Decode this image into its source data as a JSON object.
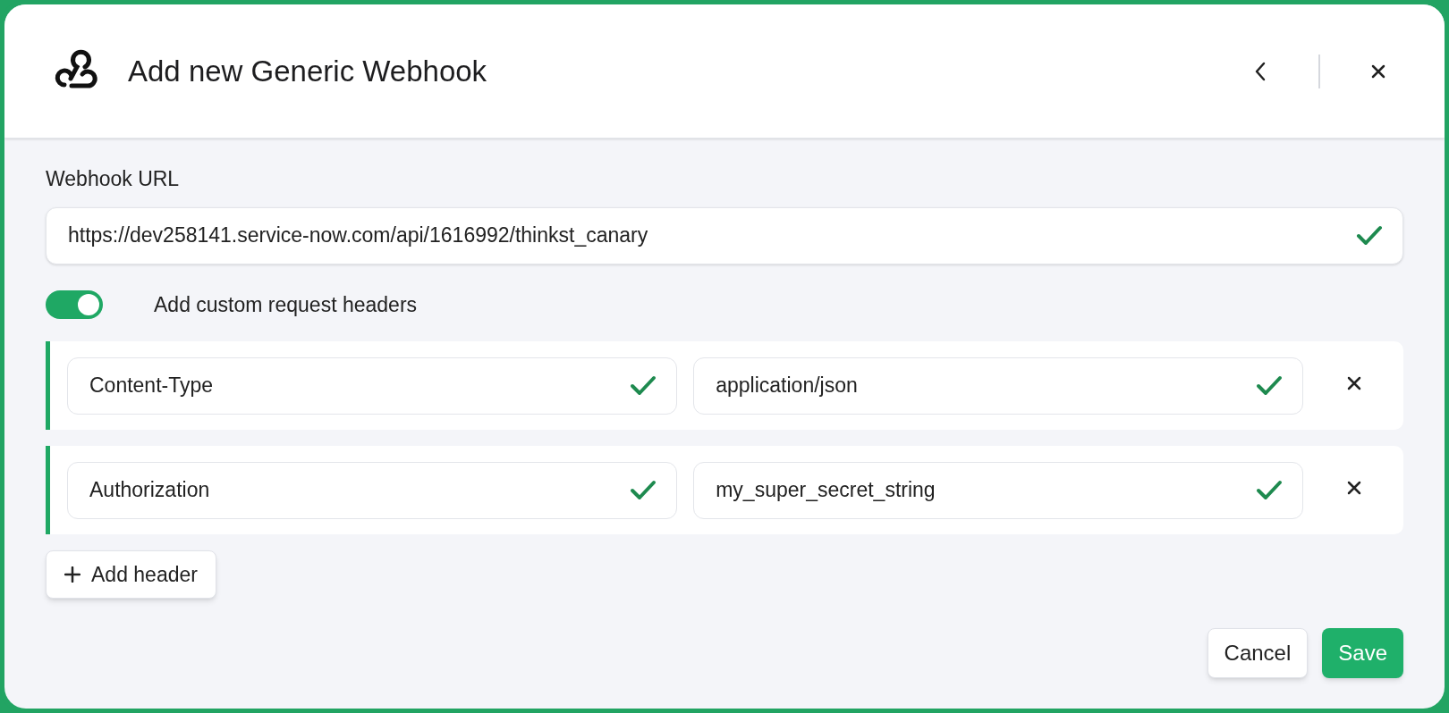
{
  "dialog": {
    "title": "Add new Generic Webhook"
  },
  "webhook_url": {
    "label": "Webhook URL",
    "value": "https://dev258141.service-now.com/api/1616992/thinkst_canary",
    "valid": true
  },
  "custom_headers_toggle": {
    "label": "Add custom request headers",
    "on": true
  },
  "headers": [
    {
      "name": "Content-Type",
      "name_valid": true,
      "value": "application/json",
      "value_valid": true
    },
    {
      "name": "Authorization",
      "name_valid": true,
      "value": "my_super_secret_string",
      "value_valid": true
    }
  ],
  "add_header_button": {
    "label": "Add header"
  },
  "buttons": [
    {
      "kind": "cancel",
      "label": "Cancel"
    },
    {
      "kind": "save",
      "label": "Save"
    }
  ]
}
